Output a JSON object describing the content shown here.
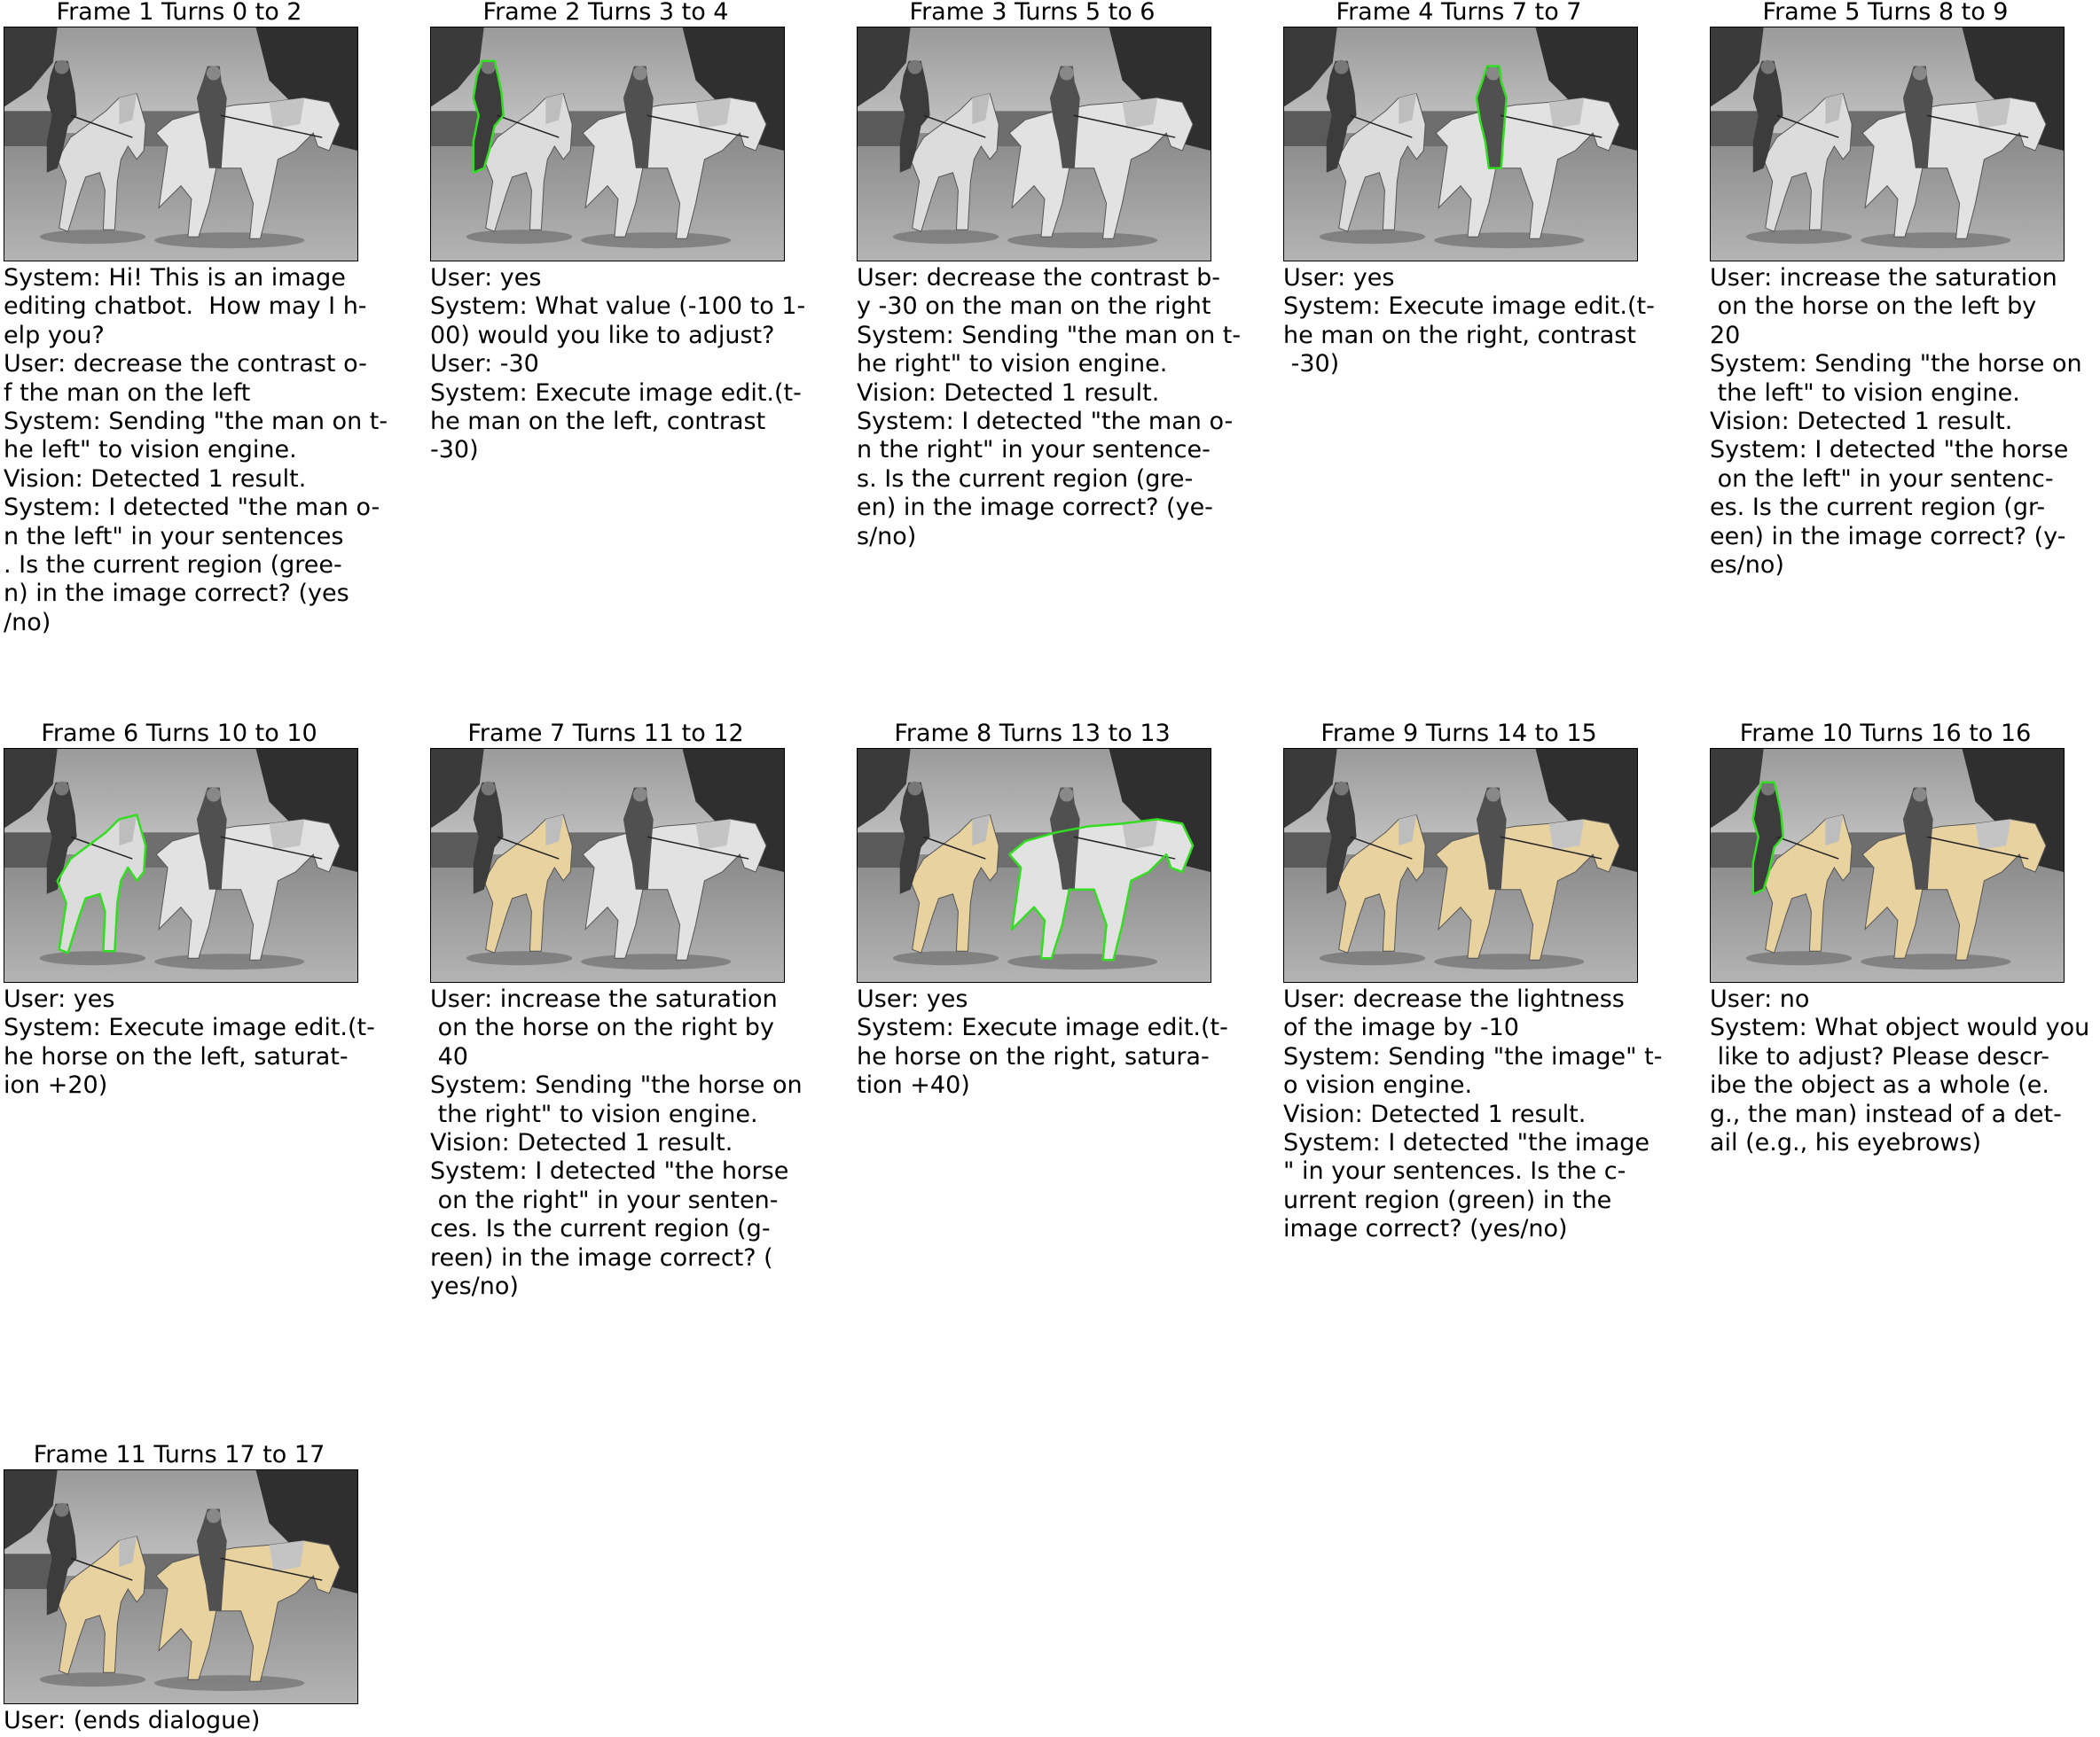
{
  "frames": [
    {
      "title": "Frame 1 Turns 0 to 2",
      "tint": "none",
      "outline": "none",
      "dialogue": "System: Hi! This is an image\nediting chatbot.  How may I h-\nelp you?\nUser: decrease the contrast o-\nf the man on the left\nSystem: Sending \"the man on t-\nhe left\" to vision engine.\nVision: Detected 1 result.\nSystem: I detected \"the man o-\nn the left\" in your sentences\n. Is the current region (gree-\nn) in the image correct? (yes\n/no)"
    },
    {
      "title": "Frame 2 Turns 3 to 4",
      "tint": "none",
      "outline": "man-left",
      "dialogue": "User: yes\nSystem: What value (-100 to 1-\n00) would you like to adjust?\nUser: -30\nSystem: Execute image edit.(t-\nhe man on the left, contrast\n-30)"
    },
    {
      "title": "Frame 3 Turns 5 to 6",
      "tint": "none",
      "outline": "none",
      "dialogue": "User: decrease the contrast b-\ny -30 on the man on the right\nSystem: Sending \"the man on t-\nhe right\" to vision engine.\nVision: Detected 1 result.\nSystem: I detected \"the man o-\nn the right\" in your sentence-\ns. Is the current region (gre-\nen) in the image correct? (ye-\ns/no)"
    },
    {
      "title": "Frame 4 Turns 7 to 7",
      "tint": "none",
      "outline": "man-right",
      "dialogue": "User: yes\nSystem: Execute image edit.(t-\nhe man on the right, contrast\n -30)"
    },
    {
      "title": "Frame 5 Turns 8 to 9",
      "tint": "none",
      "outline": "none",
      "dialogue": "User: increase the saturation\n on the horse on the left by\n20\nSystem: Sending \"the horse on\n the left\" to vision engine.\nVision: Detected 1 result.\nSystem: I detected \"the horse\n on the left\" in your sentenc-\nes. Is the current region (gr-\neen) in the image correct? (y-\nes/no)"
    },
    {
      "title": "Frame 6 Turns 10 to 10",
      "tint": "none",
      "outline": "horse-left",
      "dialogue": "User: yes\nSystem: Execute image edit.(t-\nhe horse on the left, saturat-\nion +20)"
    },
    {
      "title": "Frame 7 Turns 11 to 12",
      "tint": "left",
      "outline": "none",
      "dialogue": "User: increase the saturation\n on the horse on the right by\n 40\nSystem: Sending \"the horse on\n the right\" to vision engine.\nVision: Detected 1 result.\nSystem: I detected \"the horse\n on the right\" in your senten-\nces. Is the current region (g-\nreen) in the image correct? (\nyes/no)"
    },
    {
      "title": "Frame 8 Turns 13 to 13",
      "tint": "left",
      "outline": "horse-right",
      "dialogue": "User: yes\nSystem: Execute image edit.(t-\nhe horse on the right, satura-\ntion +40)"
    },
    {
      "title": "Frame 9 Turns 14 to 15",
      "tint": "both",
      "outline": "none",
      "dialogue": "User: decrease the lightness\nof the image by -10\nSystem: Sending \"the image\" t-\no vision engine.\nVision: Detected 1 result.\nSystem: I detected \"the image\n\" in your sentences. Is the c-\nurrent region (green) in the\nimage correct? (yes/no)"
    },
    {
      "title": "Frame 10 Turns 16 to 16",
      "tint": "both",
      "outline": "man-left",
      "dialogue": "User: no\nSystem: What object would you\n like to adjust? Please descr-\nibe the object as a whole (e.\ng., the man) instead of a det-\nail (e.g., his eyebrows)"
    },
    {
      "title": "Frame 11 Turns 17 to 17",
      "tint": "both",
      "outline": "none",
      "dialogue": "User: (ends dialogue)"
    }
  ],
  "colors": {
    "outline": "#33dd22",
    "tint": "#e8d2a0"
  }
}
